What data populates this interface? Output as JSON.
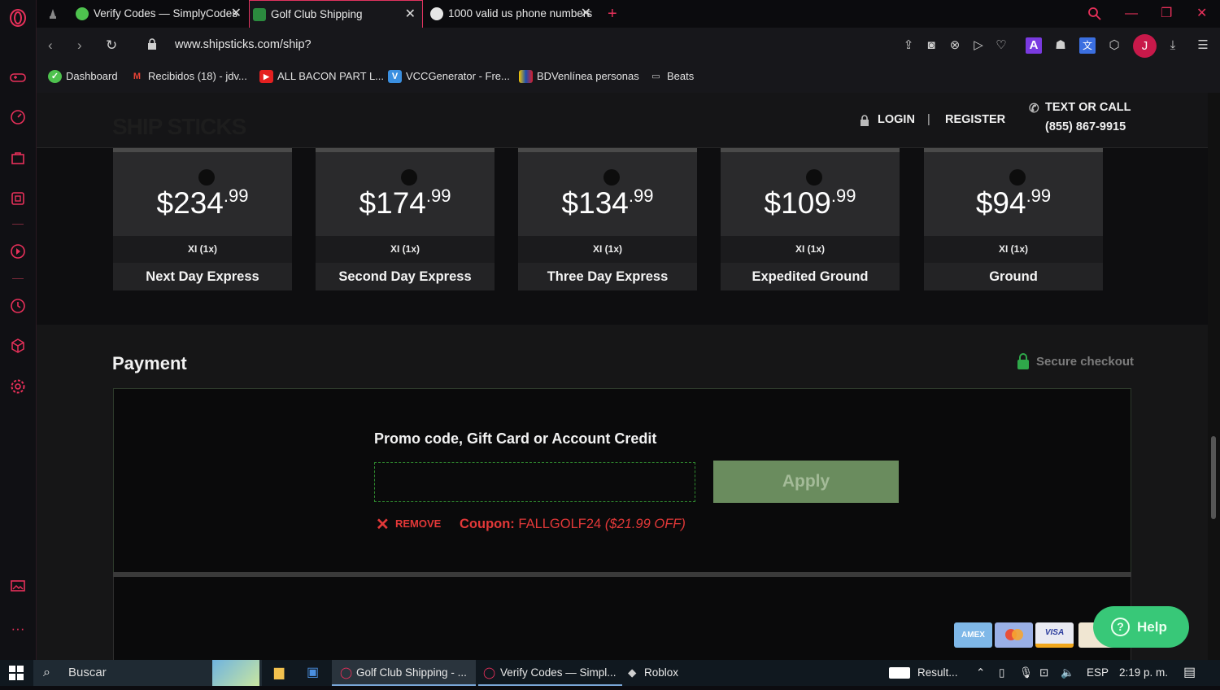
{
  "browser": {
    "tabs": [
      {
        "title": "Verify Codes — SimplyCodes",
        "active": false
      },
      {
        "title": "Golf Club Shipping",
        "active": true
      },
      {
        "title": "1000 valid us phone numbers",
        "active": false
      }
    ],
    "url": "www.shipsticks.com/ship?",
    "profile_initial": "J",
    "bookmarks": [
      {
        "label": "Dashboard"
      },
      {
        "label": "Recibidos (18) - jdv..."
      },
      {
        "label": "ALL BACON PART L..."
      },
      {
        "label": "VCCGenerator - Fre..."
      },
      {
        "label": "BDVenlínea personas"
      },
      {
        "label": "Beats"
      }
    ]
  },
  "site": {
    "logo": "SHIP STICKS",
    "login": "LOGIN",
    "register": "REGISTER",
    "separator": "|",
    "contact_label": "TEXT OR CALL",
    "contact_phone": "(855) 867-9915"
  },
  "shipping_options": [
    {
      "dollars": "$234",
      "cents": ".99",
      "qty": "XI (1x)",
      "service": "Next Day Express"
    },
    {
      "dollars": "$174",
      "cents": ".99",
      "qty": "XI (1x)",
      "service": "Second Day Express"
    },
    {
      "dollars": "$134",
      "cents": ".99",
      "qty": "XI (1x)",
      "service": "Three Day Express"
    },
    {
      "dollars": "$109",
      "cents": ".99",
      "qty": "XI (1x)",
      "service": "Expedited Ground"
    },
    {
      "dollars": "$94",
      "cents": ".99",
      "qty": "XI (1x)",
      "service": "Ground"
    }
  ],
  "payment": {
    "title": "Payment",
    "secure": "Secure checkout",
    "promo_label": "Promo code, Gift Card or Account Credit",
    "promo_value": "",
    "apply": "Apply",
    "remove": "REMOVE",
    "coupon_prefix": "Coupon:",
    "coupon_code": "FALLGOLF24",
    "coupon_off": "($21.99 OFF)",
    "cards": [
      "AMEX",
      "MC",
      "VISA",
      ""
    ]
  },
  "help": {
    "label": "Help"
  },
  "taskbar": {
    "search": "Buscar",
    "apps": [
      "Golf Club Shipping - ...",
      "Verify Codes — Simpl...",
      "Roblox"
    ],
    "news": "Result...",
    "lang": "ESP",
    "time": "2:19 p. m."
  },
  "colors": {
    "accent": "#e0335f",
    "apply_bg": "#6a8c5e",
    "coupon": "#e23838",
    "help": "#38c878"
  }
}
